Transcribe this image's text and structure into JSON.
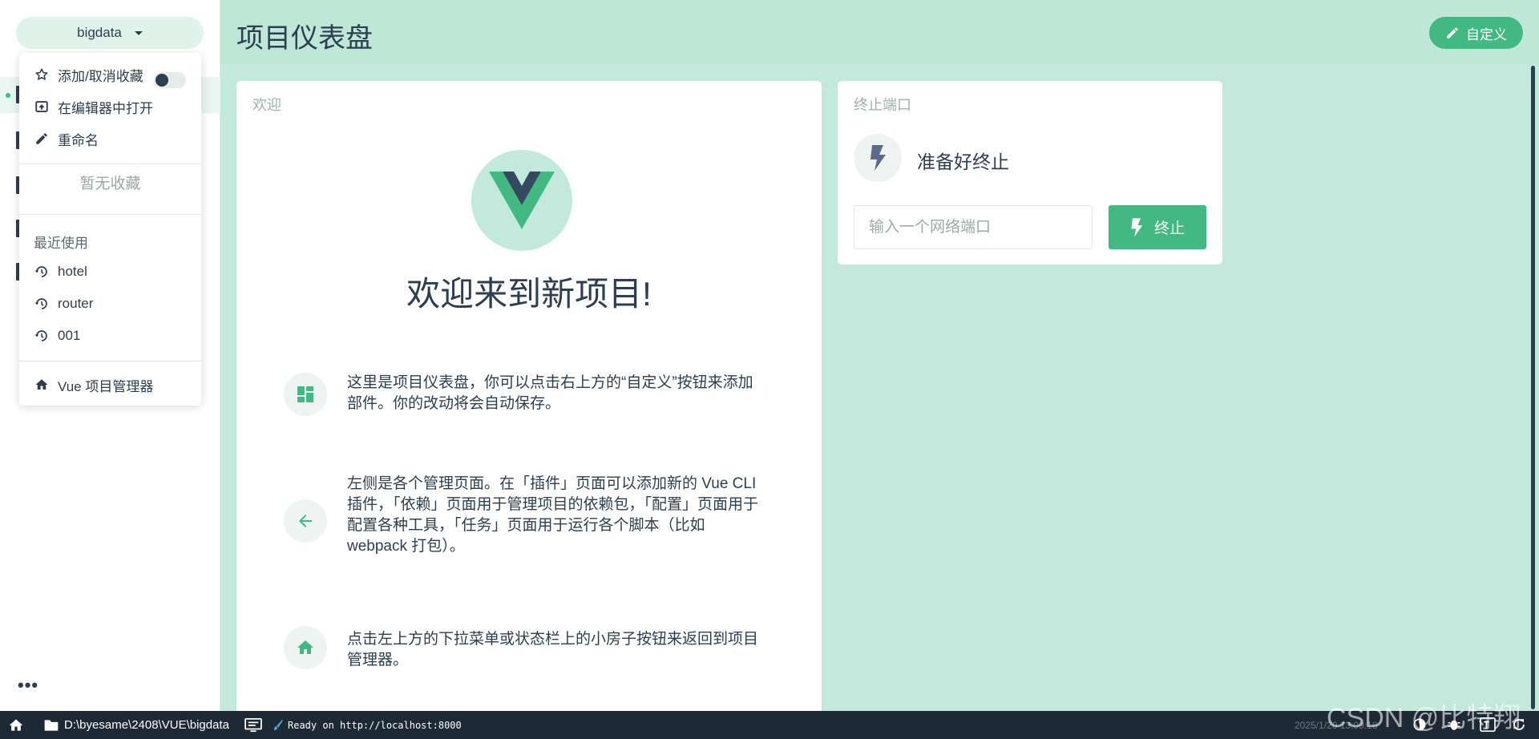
{
  "sidebar": {
    "project_name": "bigdata",
    "more_label": "•••"
  },
  "dropdown": {
    "favorite_label": "添加/取消收藏",
    "open_editor_label": "在编辑器中打开",
    "rename_label": "重命名",
    "no_favorites": "暂无收藏",
    "recent_heading": "最近使用",
    "recent": [
      "hotel",
      "router",
      "001"
    ],
    "manager_label": "Vue 项目管理器"
  },
  "header": {
    "title": "项目仪表盘",
    "customize_label": "自定义"
  },
  "welcome": {
    "card_title": "欢迎",
    "heading": "欢迎来到新项目!",
    "tips": [
      "这里是项目仪表盘，你可以点击右上方的“自定义”按钮来添加部件。你的改动将会自动保存。",
      "左侧是各个管理页面。在「插件」页面可以添加新的 Vue CLI 插件，「依赖」页面用于管理项目的依赖包，「配置」页面用于配置各种工具，「任务」页面用于运行各个脚本（比如 webpack 打包）。",
      "点击左上方的下拉菜单或状态栏上的小房子按钮来返回到项目管理器。"
    ]
  },
  "kill_port": {
    "card_title": "终止端口",
    "status": "准备好终止",
    "input_placeholder": "输入一个网络端口",
    "button_label": "终止"
  },
  "statusbar": {
    "path": "D:\\byesame\\2408\\VUE\\bigdata",
    "ready": "Ready on http://localhost:8000",
    "time": "2025/1/20 13:09:18"
  },
  "watermark": "CSDN @比特翔",
  "colors": {
    "accent": "#42b983",
    "dark": "#2c3e50",
    "background": "#c3e9dc",
    "statusbar": "#1d2935"
  }
}
